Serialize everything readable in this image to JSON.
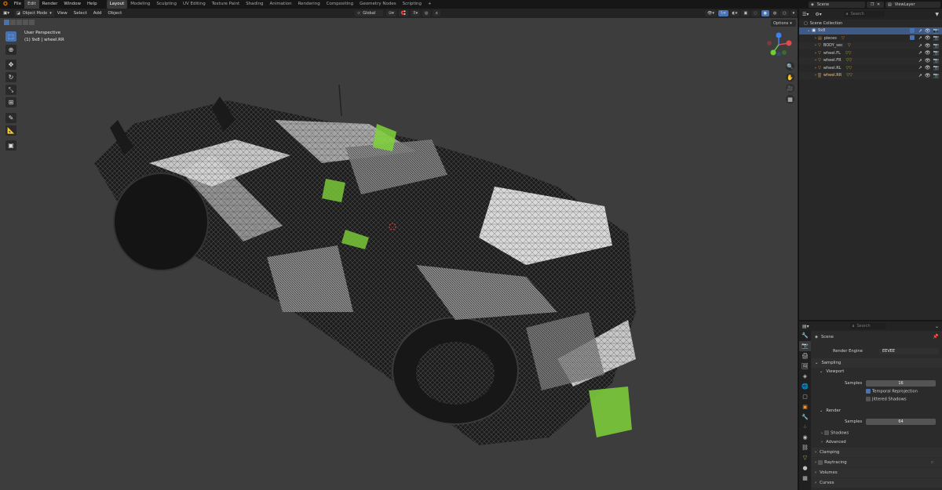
{
  "menubar": {
    "logo": "blender-logo",
    "menus": [
      "File",
      "Edit",
      "Render",
      "Window",
      "Help"
    ],
    "workspaces": [
      "Layout",
      "Modeling",
      "Sculpting",
      "UV Editing",
      "Texture Paint",
      "Shading",
      "Animation",
      "Rendering",
      "Compositing",
      "Geometry Nodes",
      "Scripting"
    ],
    "active_workspace": "Layout",
    "add_tab": "+",
    "scene_name": "Scene",
    "view_layer": "ViewLayer"
  },
  "viewport_header": {
    "mode": "Object Mode",
    "menus": [
      "View",
      "Select",
      "Add",
      "Object"
    ],
    "transform": "Global",
    "options": "Options"
  },
  "viewport": {
    "perspective": "User Perspective",
    "object_path": "(1) 9x8 | wheel.RR",
    "gizmo_axes": [
      "X",
      "Y",
      "Z"
    ]
  },
  "outliner": {
    "search_placeholder": "Search",
    "root": "Scene Collection",
    "items": [
      {
        "name": "9x8",
        "type": "collection",
        "selected": true
      },
      {
        "name": "pieces",
        "type": "object"
      },
      {
        "name": "BODY_sec",
        "type": "object"
      },
      {
        "name": "wheel.FL",
        "type": "object"
      },
      {
        "name": "wheel.FR",
        "type": "object"
      },
      {
        "name": "wheel.RL",
        "type": "object"
      },
      {
        "name": "wheel.RR",
        "type": "object"
      }
    ]
  },
  "properties": {
    "search_placeholder": "Search",
    "context": "Scene",
    "render_engine_label": "Render Engine",
    "render_engine": "EEVEE",
    "sampling": "Sampling",
    "viewport_section": "Viewport",
    "viewport_samples_label": "Samples",
    "viewport_samples": "16",
    "temporal_reprojection": "Temporal Reprojection",
    "jittered_shadows": "Jittered Shadows",
    "render_section": "Render",
    "render_samples_label": "Samples",
    "render_samples": "64",
    "shadows": "Shadows",
    "advanced": "Advanced",
    "clamping": "Clamping",
    "raytracing": "Raytracing",
    "volumes": "Volumes",
    "curves": "Curves"
  },
  "colors": {
    "accent": "#4772b3",
    "viewport_bg": "#3d3d3d",
    "panel_bg": "#282828",
    "object_orange": "#e8923a",
    "mesh_green": "#7fd23a"
  }
}
